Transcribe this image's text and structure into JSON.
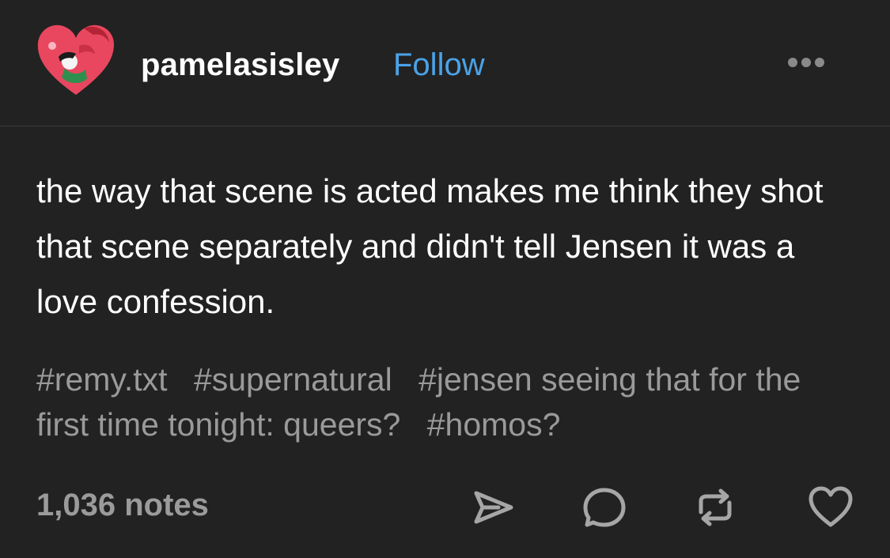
{
  "post": {
    "username": "pamelasisley",
    "follow_label": "Follow",
    "body": "the way that scene is acted makes me think they shot that scene separately and didn't tell Jensen it was a love confession.",
    "tags": [
      "#remy.txt",
      "#supernatural",
      "#jensen seeing that for the first time tonight: queers?",
      "#homos?"
    ],
    "notes": "1,036 notes"
  },
  "icons": {
    "menu": "more-dots-icon",
    "share": "share-send-icon",
    "reply": "reply-bubble-icon",
    "reblog": "reblog-icon",
    "like": "heart-icon"
  },
  "colors": {
    "background": "#222222",
    "text": "#ffffff",
    "follow": "#4aa3e8",
    "muted": "#9a9a9a",
    "avatar_heart": "#e8475f"
  }
}
